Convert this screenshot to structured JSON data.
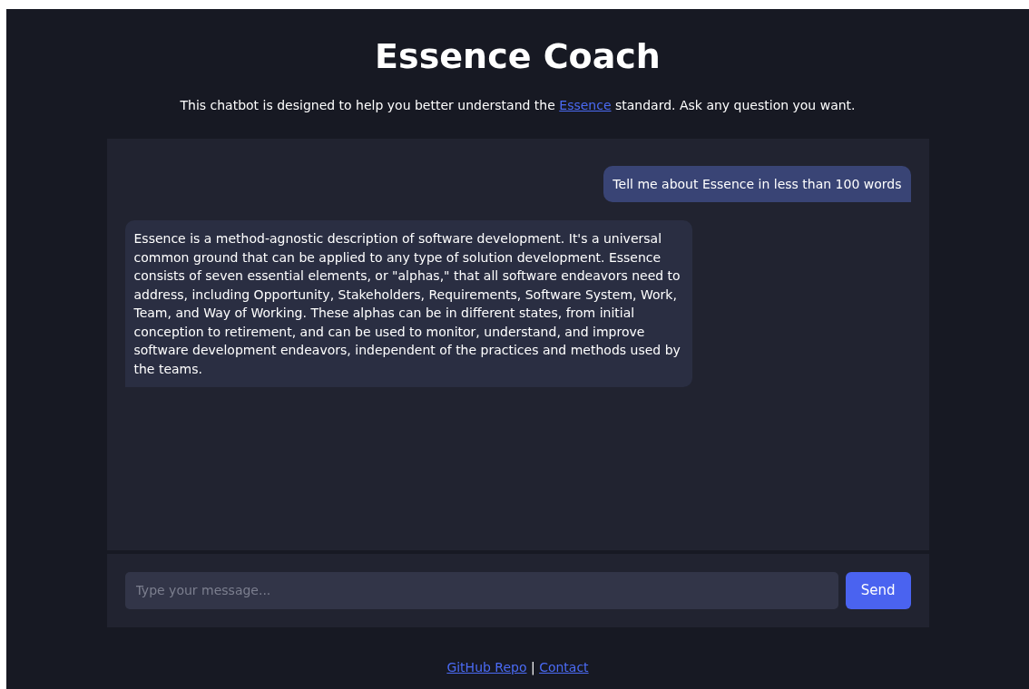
{
  "title": "Essence Coach",
  "intro": {
    "before": "This chatbot is designed to help you better understand the ",
    "link": "Essence",
    "after": " standard. Ask any question you want."
  },
  "messages": [
    {
      "kind": "user",
      "text": "Tell me about Essence in less than 100 words"
    },
    {
      "kind": "bot",
      "text": "Essence is a method-agnostic description of software development. It's a universal common ground that can be applied to any type of solution development. Essence consists of seven essential elements, or \"alphas,\" that all software endeavors need to address, including Opportunity, Stakeholders, Requirements, Software System, Work, Team, and Way of Working. These alphas can be in different states, from initial conception to retirement, and can be used to monitor, understand, and improve software development endeavors, independent of the practices and methods used by the teams."
    }
  ],
  "input": {
    "placeholder": "Type your message..."
  },
  "send_button": "Send",
  "footer": {
    "links": [
      "GitHub Repo",
      "Contact"
    ],
    "separator": "|"
  }
}
